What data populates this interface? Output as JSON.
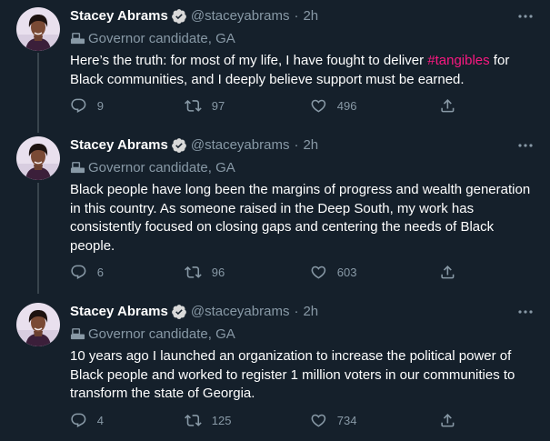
{
  "colors": {
    "background": "#15202b",
    "text": "#ffffff",
    "secondary": "#8899a6",
    "hashtag": "#f91880",
    "verified": "#d9d9d9"
  },
  "tweets": [
    {
      "name": "Stacey Abrams",
      "handle": "@staceyabrams",
      "separator": "·",
      "time": "2h",
      "label": "Governor candidate, GA",
      "text_before": "Here’s the truth: for most of my life, I have fought to deliver ",
      "hashtag": "#tangibles",
      "text_after": " for Black communities, and I deeply believe support must be earned.",
      "replies": "9",
      "retweets": "97",
      "likes": "496",
      "icons": [
        "reply-icon",
        "retweet-icon",
        "like-icon",
        "share-icon"
      ]
    },
    {
      "name": "Stacey Abrams",
      "handle": "@staceyabrams",
      "separator": "·",
      "time": "2h",
      "label": "Governor candidate, GA",
      "text": "Black people have long been the margins of progress and wealth generation in this country. As someone raised in the Deep South, my work has consistently focused on closing gaps and centering the needs of Black people.",
      "replies": "6",
      "retweets": "96",
      "likes": "603"
    },
    {
      "name": "Stacey Abrams",
      "handle": "@staceyabrams",
      "separator": "·",
      "time": "2h",
      "label": "Governor candidate, GA",
      "text": "10 years ago I launched an organization to increase the political power of Black people and worked to register 1 million voters in our communities to transform the state of Georgia.",
      "replies": "4",
      "retweets": "125",
      "likes": "734"
    }
  ]
}
